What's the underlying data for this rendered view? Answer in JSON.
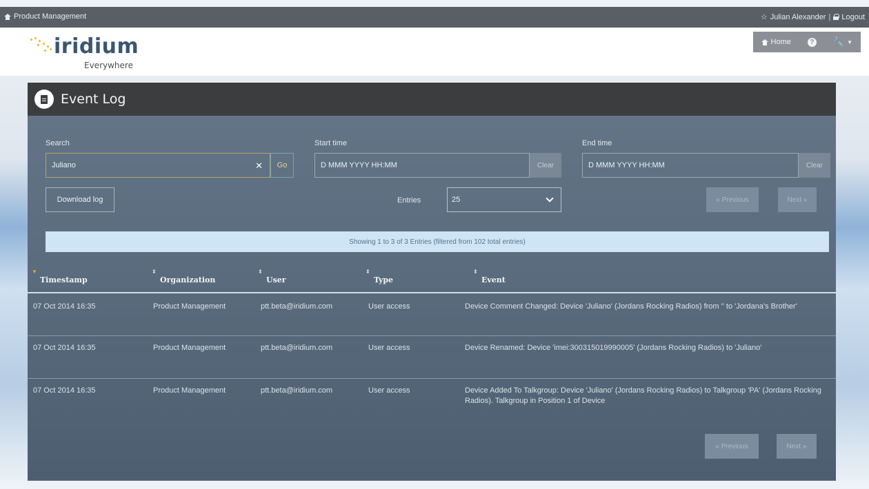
{
  "topbar": {
    "breadcrumb": "Product Management",
    "user": "Julian Alexander",
    "separator": "|",
    "logout": "Logout"
  },
  "header": {
    "brand": "iridium",
    "tagline": "Everywhere",
    "home_label": "Home",
    "help_label": "?"
  },
  "panel": {
    "title": "Event Log"
  },
  "filters": {
    "search_label": "Search",
    "search_value": "Juliano",
    "go_label": "Go",
    "start_label": "Start time",
    "start_placeholder": "D MMM YYYY HH:MM",
    "end_label": "End time",
    "end_placeholder": "D MMM YYYY HH:MM",
    "clear_label": "Clear",
    "download_label": "Download log",
    "entries_label": "Entries",
    "entries_value": "25",
    "prev_label": "« Previous",
    "next_label": "Next »"
  },
  "info": "Showing 1 to 3 of 3 Entries (filtered from 102 total entries)",
  "table": {
    "columns": [
      "Timestamp",
      "Organization",
      "User",
      "Type",
      "Event"
    ],
    "rows": [
      {
        "timestamp": "07 Oct 2014 16:35",
        "organization": "Product Management",
        "user": "ptt.beta@iridium.com",
        "type": "User access",
        "event": "Device Comment Changed: Device 'Juliano' (Jordans Rocking Radios) from '' to 'Jordana's Brother'"
      },
      {
        "timestamp": "07 Oct 2014 16:35",
        "organization": "Product Management",
        "user": "ptt.beta@iridium.com",
        "type": "User access",
        "event": "Device Renamed: Device 'imei:300315019990005' (Jordans Rocking Radios) to 'Juliano'"
      },
      {
        "timestamp": "07 Oct 2014 16:35",
        "organization": "Product Management",
        "user": "ptt.beta@iridium.com",
        "type": "User access",
        "event": "Device Added To Talkgroup: Device 'Juliano' (Jordans Rocking Radios) to Talkgroup 'PA' (Jordans Rocking Radios). Talkgroup in Position 1 of Device"
      }
    ]
  },
  "colors": {
    "topbar": "#5a5f66",
    "panel_header": "#3c3d3f",
    "panel_body": "#5a6b7e",
    "info_bar": "#cfe5f5",
    "brand_text": "#3b5770",
    "brand_dots": "#f0b323",
    "sort_active": "#f0a23a"
  }
}
